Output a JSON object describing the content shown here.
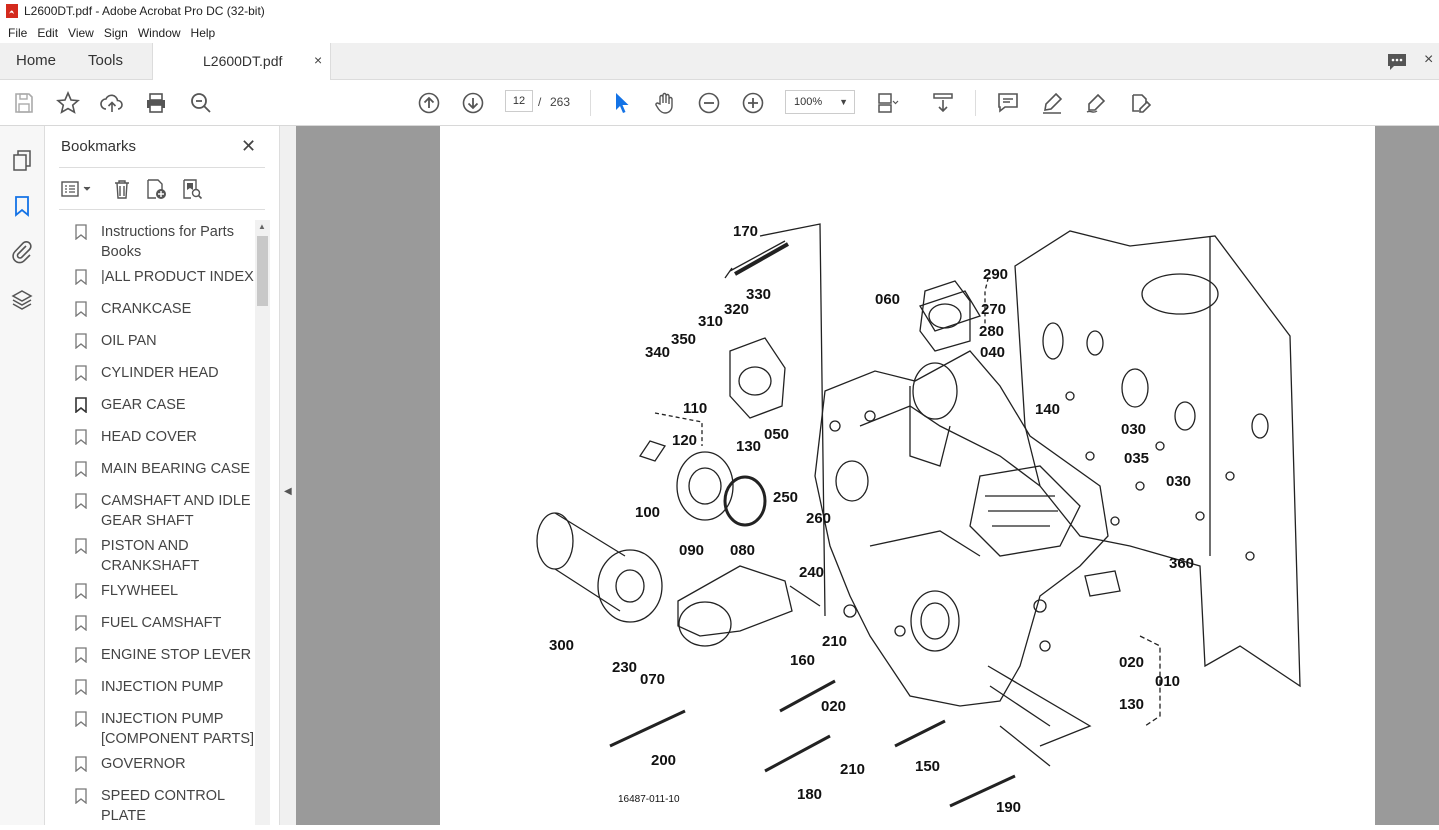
{
  "window": {
    "title": "L2600DT.pdf - Adobe Acrobat Pro DC (32-bit)"
  },
  "menu": [
    "File",
    "Edit",
    "View",
    "Sign",
    "Window",
    "Help"
  ],
  "tabs": {
    "home": "Home",
    "tools": "Tools",
    "document": "L2600DT.pdf",
    "close_glyph": "×"
  },
  "toolbar": {
    "current_page": "12",
    "page_separator": "/",
    "total_pages": "263",
    "zoom": "100%"
  },
  "bookmarks": {
    "title": "Bookmarks",
    "items": [
      "Instructions for Parts Books",
      "|ALL PRODUCT INDEX",
      "CRANKCASE",
      "OIL PAN",
      "CYLINDER HEAD",
      "GEAR CASE",
      "HEAD COVER",
      "MAIN BEARING CASE",
      "CAMSHAFT AND IDLE GEAR SHAFT",
      "PISTON AND CRANKSHAFT",
      "FLYWHEEL",
      "FUEL CAMSHAFT",
      "ENGINE STOP LEVER",
      "INJECTION PUMP",
      "INJECTION PUMP [COMPONENT PARTS]",
      "GOVERNOR",
      "SPEED CONTROL PLATE"
    ]
  },
  "diagram": {
    "labels": [
      "170",
      "290",
      "330",
      "320",
      "270",
      "060",
      "280",
      "310",
      "340",
      "350",
      "040",
      "110",
      "140",
      "130",
      "050",
      "120",
      "030",
      "035",
      "030",
      "100",
      "250",
      "260",
      "090",
      "080",
      "240",
      "360",
      "300",
      "210",
      "160",
      "020",
      "010",
      "230",
      "070",
      "020",
      "130",
      "200",
      "210",
      "150",
      "180",
      "190"
    ],
    "code": "16487-011-10"
  },
  "colors": {
    "accent_blue": "#1473e6",
    "viewer_bg": "#9a9a9a",
    "acrobat_red": "#d42a1d"
  }
}
